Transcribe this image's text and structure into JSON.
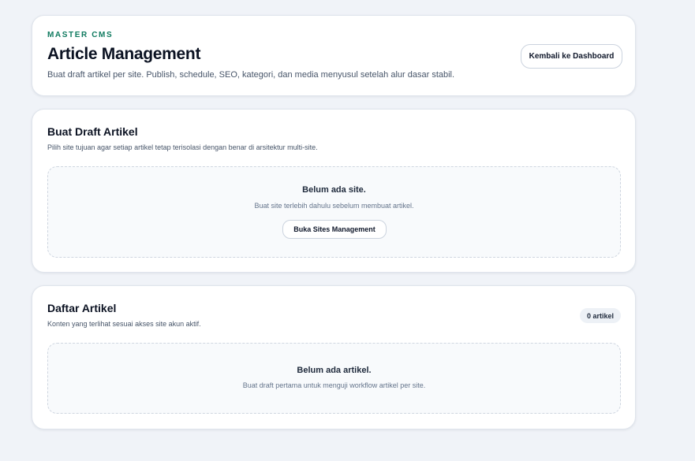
{
  "header": {
    "eyebrow": "MASTER CMS",
    "title": "Article Management",
    "description": "Buat draft artikel per site. Publish, schedule, SEO, kategori, dan media menyusul setelah alur dasar stabil.",
    "back_button_label": "Kembali ke Dashboard"
  },
  "draft_section": {
    "title": "Buat Draft Artikel",
    "description": "Pilih site tujuan agar setiap artikel tetap terisolasi dengan benar di arsitektur multi-site.",
    "empty_title": "Belum ada site.",
    "empty_description": "Buat site terlebih dahulu sebelum membuat artikel.",
    "empty_button_label": "Buka Sites Management"
  },
  "list_section": {
    "title": "Daftar Artikel",
    "description": "Konten yang terlihat sesuai akses site akun aktif.",
    "count_badge": "0 artikel",
    "empty_title": "Belum ada artikel.",
    "empty_description": "Buat draft pertama untuk menguji workflow artikel per site."
  },
  "colors": {
    "page_background": "#f0f3f8",
    "eyebrow_accent": "#0f7a5f",
    "card_background": "#ffffff"
  }
}
